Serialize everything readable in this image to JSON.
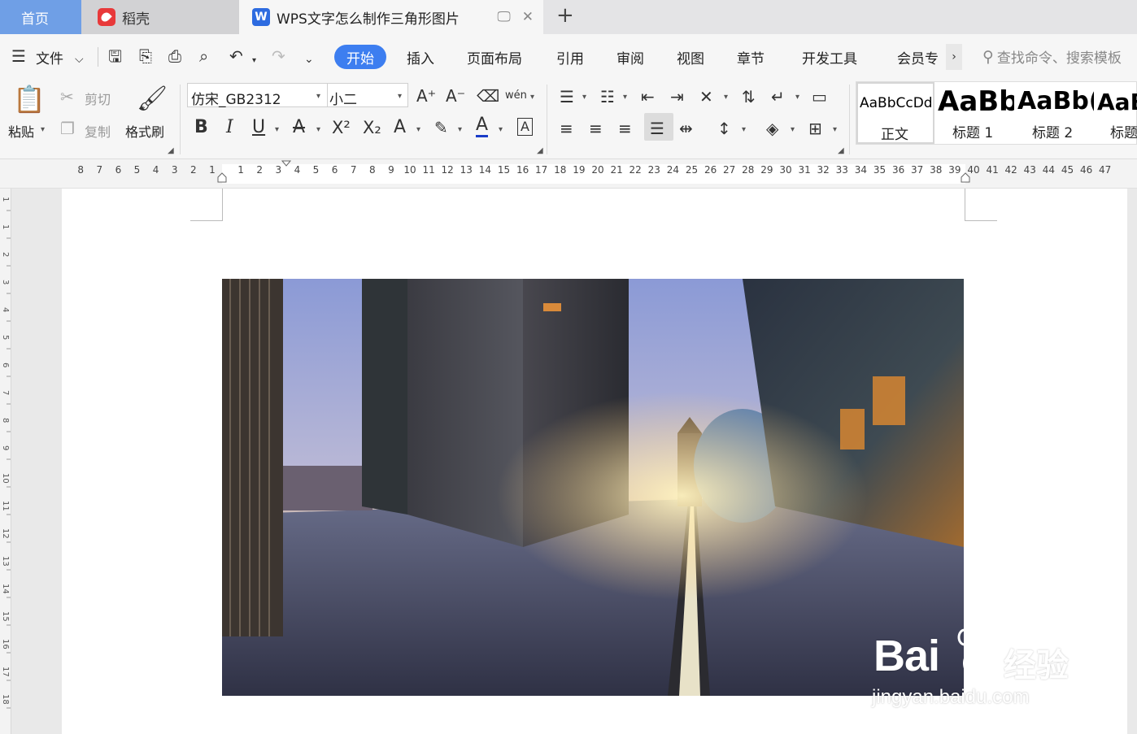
{
  "tabs": {
    "home": "首页",
    "daoke": "稻壳",
    "document": "WPS文字怎么制作三角形图片"
  },
  "menu": {
    "file": "文件",
    "items": [
      "开始",
      "插入",
      "页面布局",
      "引用",
      "审阅",
      "视图",
      "章节",
      "开发工具",
      "会员专"
    ],
    "search_placeholder": "查找命令、搜索模板"
  },
  "ribbon": {
    "paste": "粘贴",
    "cut": "剪切",
    "copy": "复制",
    "format_painter": "格式刷",
    "font_name": "仿宋_GB2312",
    "font_size": "小二",
    "phonetic": "wén",
    "styles": [
      {
        "sample": "AaBbCcDd",
        "name": "正文"
      },
      {
        "sample": "AaBb",
        "name": "标题 1"
      },
      {
        "sample": "AaBb(",
        "name": "标题 2"
      },
      {
        "sample": "AaB",
        "name": "标题"
      }
    ]
  },
  "ruler": {
    "left_numbers": [
      "8",
      "7",
      "6",
      "5",
      "4",
      "3",
      "2",
      "1"
    ],
    "right_numbers": [
      "1",
      "2",
      "3",
      "4",
      "5",
      "6",
      "7",
      "8",
      "9",
      "10",
      "11",
      "12",
      "13",
      "14",
      "15",
      "16",
      "17",
      "18",
      "19",
      "20",
      "21",
      "22",
      "23",
      "24",
      "25",
      "26",
      "27",
      "28",
      "29",
      "30",
      "31",
      "32",
      "33",
      "34",
      "35",
      "36",
      "37",
      "38",
      "39",
      "40",
      "41",
      "42",
      "43",
      "44",
      "45",
      "46",
      "47"
    ],
    "vertical_numbers": [
      "1",
      "1",
      "2",
      "3",
      "4",
      "5",
      "6",
      "7",
      "8",
      "9",
      "10",
      "11",
      "12",
      "13",
      "14",
      "15",
      "16",
      "17",
      "18"
    ]
  },
  "watermark": {
    "brand": "Bai",
    "brand_cn": "经验",
    "url": "jingyan.baidu.com"
  },
  "colors": {
    "accent": "#3d7ef0",
    "home_tab": "#6f9fe6",
    "font_color_bar": "#1a3cc8"
  }
}
